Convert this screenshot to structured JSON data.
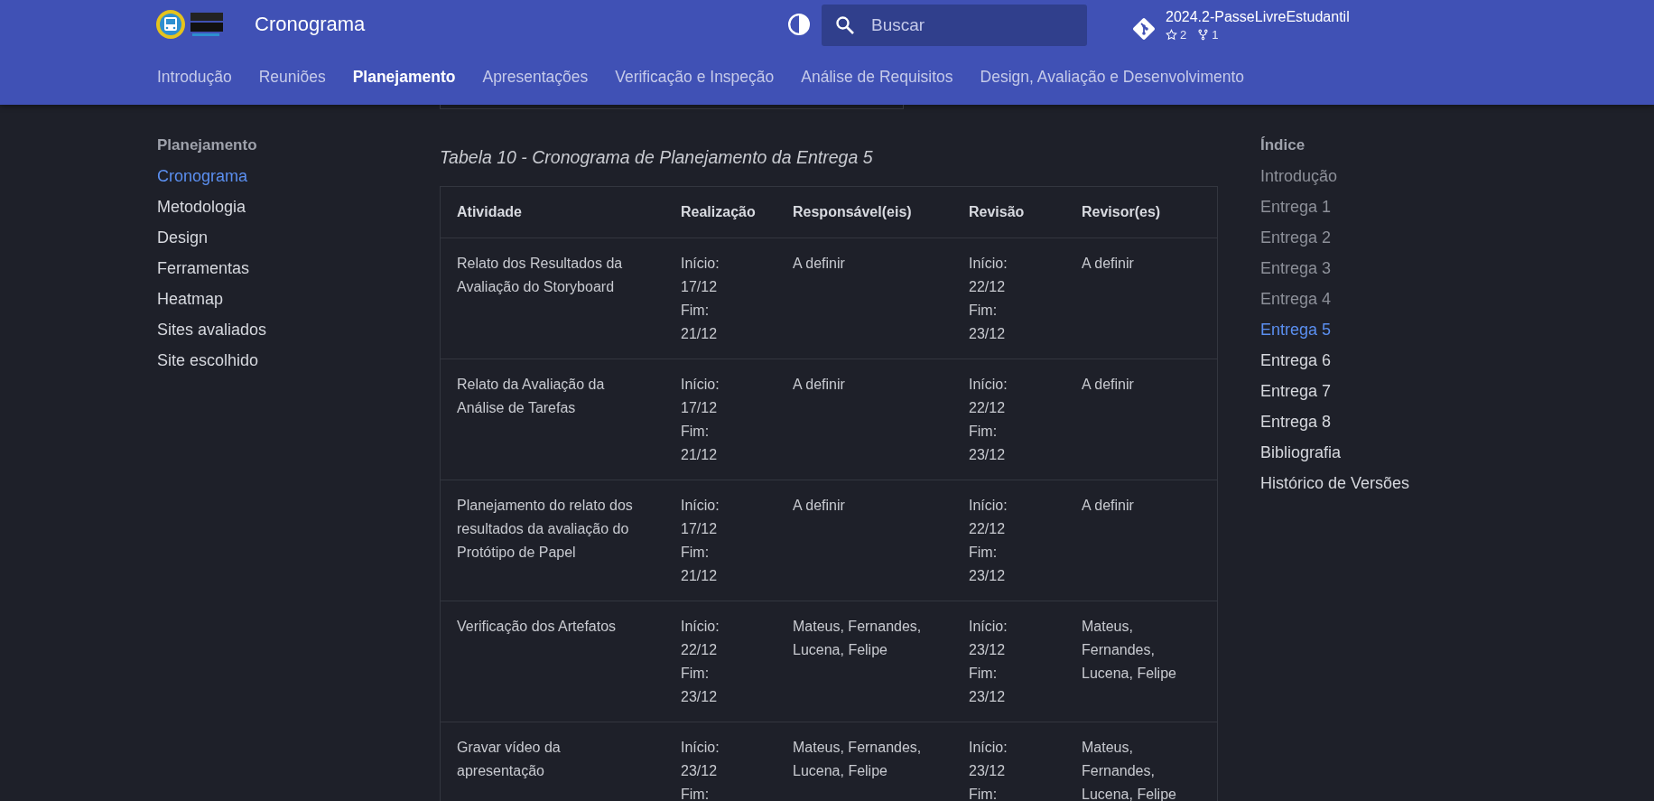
{
  "header": {
    "title": "Cronograma",
    "search": {
      "placeholder": "Buscar"
    },
    "repo": {
      "name": "2024.2-PasseLivreEstudantil",
      "stars": "2",
      "forks": "1"
    }
  },
  "tabs": [
    {
      "label": "Introdução",
      "selected": false
    },
    {
      "label": "Reuniões",
      "selected": false
    },
    {
      "label": "Planejamento",
      "selected": true
    },
    {
      "label": "Apresentações",
      "selected": false
    },
    {
      "label": "Verificação e Inspeção",
      "selected": false
    },
    {
      "label": "Análise de Requisitos",
      "selected": false
    },
    {
      "label": "Design, Avaliação e Desenvolvimento",
      "selected": false
    }
  ],
  "sidebar": {
    "title": "Planejamento",
    "items": [
      {
        "label": "Cronograma",
        "selected": true
      },
      {
        "label": "Metodologia",
        "selected": false
      },
      {
        "label": "Design",
        "selected": false
      },
      {
        "label": "Ferramentas",
        "selected": false
      },
      {
        "label": "Heatmap",
        "selected": false
      },
      {
        "label": "Sites avaliados",
        "selected": false
      },
      {
        "label": "Site escolhido",
        "selected": false
      }
    ]
  },
  "caption": "Tabela 10 - Cronograma de Planejamento da Entrega 5",
  "table": {
    "columns": [
      "Atividade",
      "Realização",
      "Responsável(eis)",
      "Revisão",
      "Revisor(es)"
    ],
    "rows": [
      [
        [
          "Relato dos Resultados da Avaliação do Storyboard"
        ],
        [
          "Início:",
          "17/12",
          "Fim:",
          "21/12"
        ],
        [
          "A definir"
        ],
        [
          "Início:",
          "22/12",
          "Fim:",
          "23/12"
        ],
        [
          "A definir"
        ]
      ],
      [
        [
          "Relato da Avaliação da Análise de Tarefas"
        ],
        [
          "Início:",
          "17/12",
          "Fim:",
          "21/12"
        ],
        [
          "A definir"
        ],
        [
          "Início:",
          "22/12",
          "Fim:",
          "23/12"
        ],
        [
          "A definir"
        ]
      ],
      [
        [
          "Planejamento do relato dos resultados da avaliação do Protótipo de Papel"
        ],
        [
          "Início:",
          "17/12",
          "Fim:",
          "21/12"
        ],
        [
          "A definir"
        ],
        [
          "Início:",
          "22/12",
          "Fim:",
          "23/12"
        ],
        [
          "A definir"
        ]
      ],
      [
        [
          "Verificação dos Artefatos"
        ],
        [
          "Início:",
          "22/12",
          "Fim:",
          "23/12"
        ],
        [
          "Mateus, Fernandes, Lucena, Felipe"
        ],
        [
          "Início:",
          "23/12",
          "Fim:",
          "23/12"
        ],
        [
          "Mateus, Fernandes, Lucena, Felipe"
        ]
      ],
      [
        [
          "Gravar vídeo da apresentação"
        ],
        [
          "Início:",
          "23/12",
          "Fim:"
        ],
        [
          "Mateus, Fernandes, Lucena, Felipe"
        ],
        [
          "Início:",
          "23/12",
          "Fim:"
        ],
        [
          "Mateus, Fernandes, Lucena, Felipe"
        ]
      ]
    ]
  },
  "toc": {
    "title": "Índice",
    "items": [
      {
        "label": "Introdução",
        "passed": true,
        "selected": false
      },
      {
        "label": "Entrega 1",
        "passed": true,
        "selected": false
      },
      {
        "label": "Entrega 2",
        "passed": true,
        "selected": false
      },
      {
        "label": "Entrega 3",
        "passed": true,
        "selected": false
      },
      {
        "label": "Entrega 4",
        "passed": true,
        "selected": false
      },
      {
        "label": "Entrega 5",
        "passed": false,
        "selected": true
      },
      {
        "label": "Entrega 6",
        "passed": false,
        "selected": false
      },
      {
        "label": "Entrega 7",
        "passed": false,
        "selected": false
      },
      {
        "label": "Entrega 8",
        "passed": false,
        "selected": false
      },
      {
        "label": "Bibliografia",
        "passed": false,
        "selected": false
      },
      {
        "label": "Histórico de Versões",
        "passed": false,
        "selected": false
      }
    ]
  }
}
